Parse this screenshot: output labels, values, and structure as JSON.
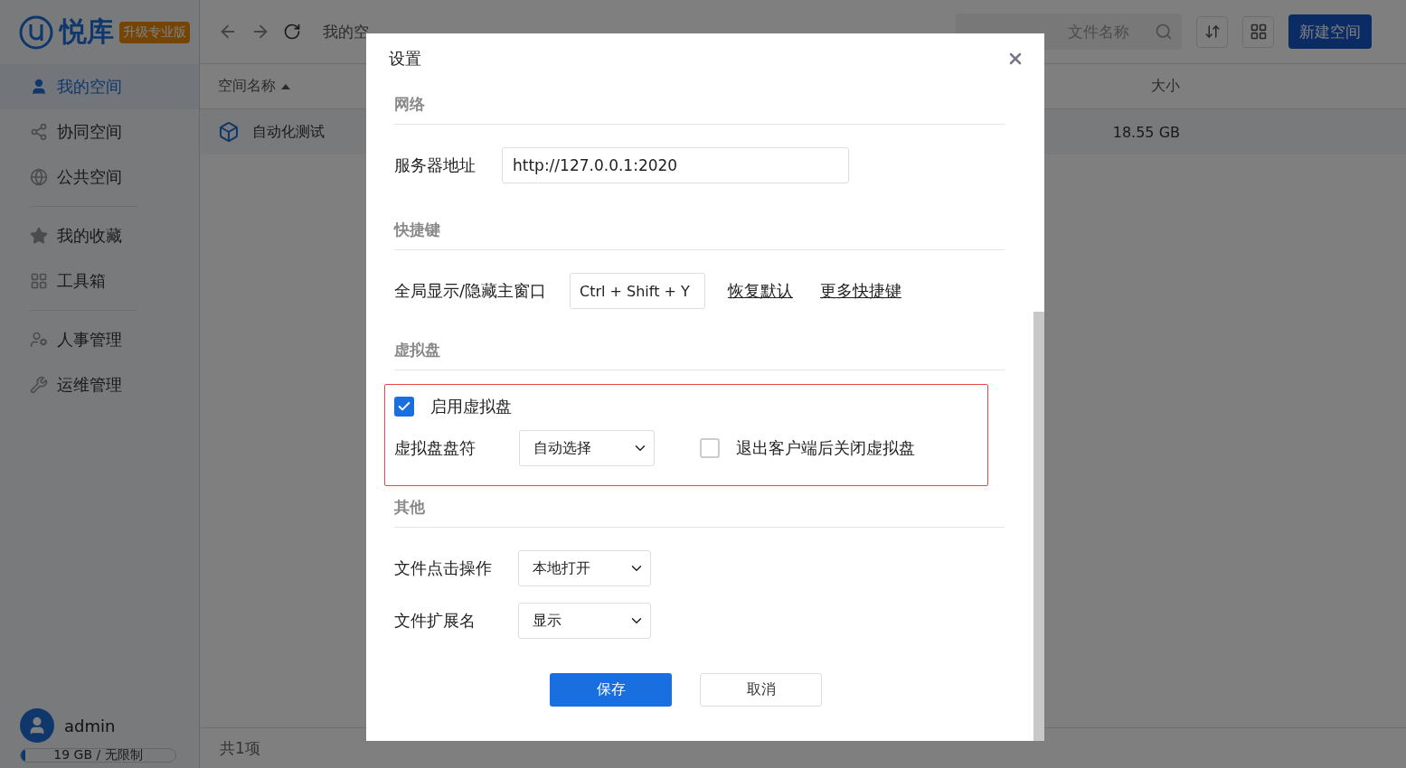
{
  "app": {
    "logo": "悦库",
    "upgrade_badge": "升级专业版"
  },
  "sidebar": {
    "groups": [
      [
        {
          "label": "我的空间",
          "selected": true
        },
        {
          "label": "协同空间",
          "selected": false
        },
        {
          "label": "公共空间",
          "selected": false
        }
      ],
      [
        {
          "label": "我的收藏",
          "selected": false
        },
        {
          "label": "工具箱",
          "selected": false
        }
      ],
      [
        {
          "label": "人事管理",
          "selected": false
        },
        {
          "label": "运维管理",
          "selected": false
        }
      ]
    ],
    "user": {
      "name": "admin",
      "storage": "19 GB / 无限制",
      "level": 0.03
    }
  },
  "toolbar": {
    "breadcrumb": "我的空",
    "search_placeholder": "文件名称",
    "new_button": "新建空间"
  },
  "table": {
    "columns": [
      {
        "label": "空间名称",
        "sorted": true
      },
      {
        "label": "大小",
        "sorted": false
      }
    ],
    "rows": [
      {
        "name": "自动化测试",
        "size": "18.55 GB"
      }
    ],
    "footer": "共1项"
  },
  "dialog": {
    "title": "设置",
    "network": {
      "title": "网络",
      "server_label": "服务器地址",
      "server_value": "http://127.0.0.1:2020"
    },
    "shortcuts": {
      "title": "快捷键",
      "label": "全局显示/隐藏主窗口",
      "keys": "Ctrl + Shift + Y",
      "reset_link": "恢复默认",
      "more_link": "更多快捷键"
    },
    "virtual_disk": {
      "title": "虚拟盘",
      "highlighted": true,
      "enable": {
        "label": "启用虚拟盘",
        "checked": true
      },
      "drive": {
        "label": "虚拟盘盘符",
        "value": "自动选择"
      },
      "close_on_exit": {
        "label": "退出客户端后关闭虚拟盘",
        "checked": false
      }
    },
    "other": {
      "title": "其他",
      "rows": [
        {
          "label": "文件点击操作",
          "value": "本地打开"
        },
        {
          "label": "文件扩展名",
          "value": "显示"
        }
      ]
    },
    "buttons": {
      "save": "保存",
      "cancel": "取消"
    }
  }
}
